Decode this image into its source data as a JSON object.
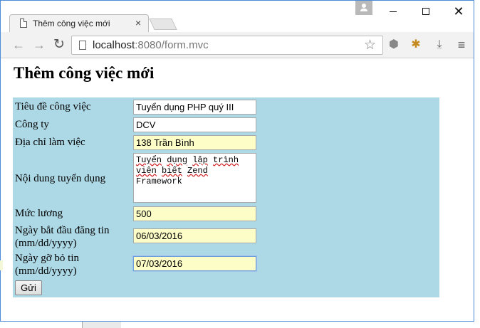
{
  "browser": {
    "tab_title": "Thêm công việc mới",
    "tab_close": "×",
    "url_host": "localhost",
    "url_rest": ":8080/form.mvc",
    "icons": [
      "page-icon",
      "close-icon",
      "back-icon",
      "forward-icon",
      "reload-icon",
      "star-icon",
      "extension-cube-icon",
      "extension-bug-icon",
      "download-icon",
      "menu-icon",
      "profile-icon",
      "minimize-icon",
      "maximize-icon",
      "close-window-icon"
    ]
  },
  "page": {
    "heading": "Thêm công việc mới",
    "form": {
      "title_label": "Tiêu đề công việc",
      "title_value": "Tuyển dụng PHP quý III",
      "company_label": "Công ty",
      "company_value": "DCV",
      "address_label": "Địa chỉ làm việc",
      "address_value": "138 Trần Bình",
      "content_label": "Nội dung tuyển dụng",
      "content_line1_a": "Tuyển",
      "content_line1_b": " ",
      "content_line1_c": "dụng",
      "content_line1_d": " ",
      "content_line1_e": "lập",
      "content_line1_f": " ",
      "content_line1_g": "trình",
      "content_line2_a": "viên",
      "content_line2_b": " ",
      "content_line2_c": "biết",
      "content_line2_d": " ",
      "content_line2_e": "Zend",
      "content_line3": "Framework",
      "salary_label": "Mức lương",
      "salary_value": "500",
      "start_label_1": "Ngày bắt đầu đăng tin",
      "start_label_2": "(mm/dd/yyyy)",
      "start_value": "06/03/2016",
      "end_label_1": "Ngày gỡ bỏ tin",
      "end_label_2": "(mm/dd/yyyy)",
      "end_value": "07/03/2016",
      "submit_label": "Gửi"
    }
  },
  "colors": {
    "form_background": "#add8e6",
    "autofill_yellow": "#fdfdc8",
    "window_border": "#4a8ad8"
  }
}
